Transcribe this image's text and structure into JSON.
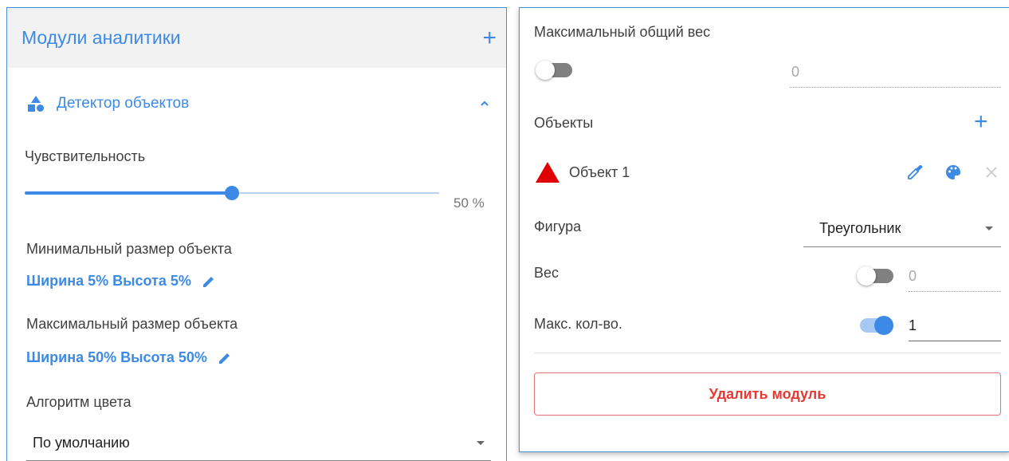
{
  "left": {
    "title": "Модули аналитики",
    "add_icon": "plus-icon",
    "module": {
      "name": "Детектор объектов",
      "icon": "shapes-icon",
      "expand_icon": "chevron-up-icon"
    },
    "sensitivity": {
      "label": "Чувствительность",
      "value": 50,
      "value_text": "50 %"
    },
    "min_size": {
      "label": "Минимальный размер объекта",
      "value": "Ширина 5% Высота 5%",
      "edit_icon": "pencil-icon"
    },
    "max_size": {
      "label": "Максимальный размер объекта",
      "value": "Ширина 50% Высота 50%",
      "edit_icon": "pencil-icon"
    },
    "color_algorithm": {
      "label": "Алгоритм цвета",
      "value": "По умолчанию"
    }
  },
  "right": {
    "max_total_weight": {
      "label": "Максимальный общий вес",
      "toggle_on": false,
      "value": "0"
    },
    "objects": {
      "label": "Объекты",
      "add_icon": "plus-icon"
    },
    "object": {
      "name": "Объект 1",
      "shape_icon": "triangle-icon",
      "shape_color": "#e00000",
      "actions": [
        "eyedropper-icon",
        "palette-icon",
        "close-icon"
      ]
    },
    "shape": {
      "label": "Фигура",
      "value": "Треугольник"
    },
    "weight": {
      "label": "Вес",
      "toggle_on": false,
      "value": "0"
    },
    "max_count": {
      "label": "Макс. кол-во.",
      "toggle_on": true,
      "value": "1"
    },
    "delete_button": "Удалить модуль"
  },
  "colors": {
    "accent": "#3d8ae6",
    "danger": "#e53935",
    "panel_border": "#4a90d9"
  }
}
